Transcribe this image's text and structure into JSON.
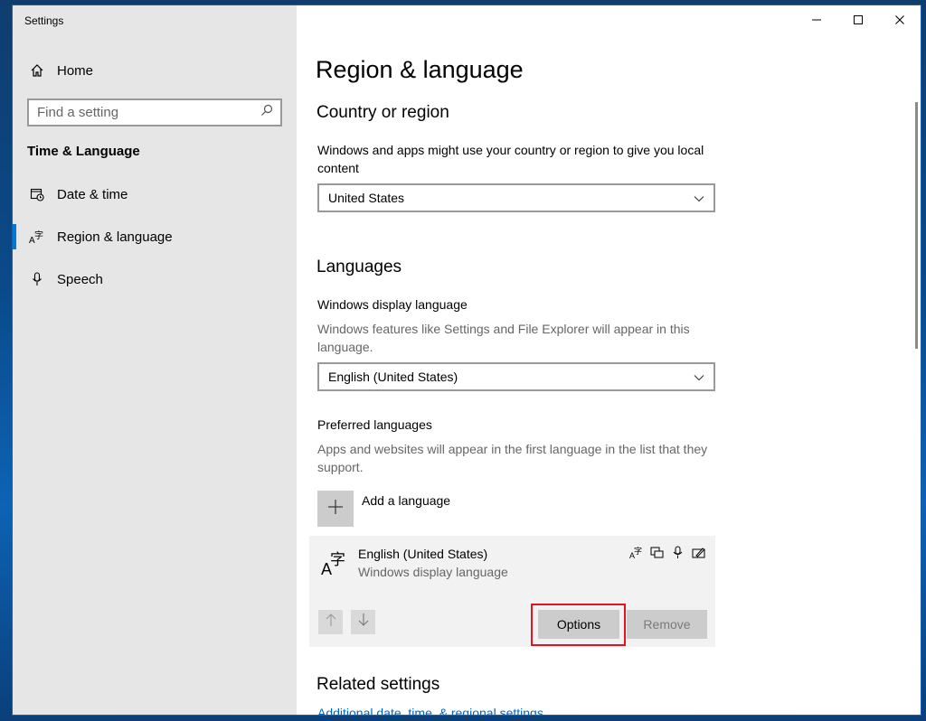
{
  "window": {
    "title": "Settings",
    "controls": [
      "minimize",
      "maximize",
      "close"
    ]
  },
  "sidebar": {
    "home_label": "Home",
    "search_placeholder": "Find a setting",
    "section_title": "Time & Language",
    "items": [
      {
        "label": "Date & time",
        "icon": "calendar-clock-icon",
        "selected": false
      },
      {
        "label": "Region & language",
        "icon": "language-icon",
        "selected": true
      },
      {
        "label": "Speech",
        "icon": "microphone-icon",
        "selected": false
      }
    ]
  },
  "main": {
    "page_title": "Region & language",
    "country": {
      "heading": "Country or region",
      "description": "Windows and apps might use your country or region to give you local content",
      "selected": "United States"
    },
    "languages": {
      "heading": "Languages",
      "display_label": "Windows display language",
      "display_description": "Windows features like Settings and File Explorer will appear in this language.",
      "display_selected": "English (United States)",
      "preferred_label": "Preferred languages",
      "preferred_description": "Apps and websites will appear in the first language in the list that they support.",
      "add_label": "Add a language",
      "entries": [
        {
          "name": "English (United States)",
          "subtitle": "Windows display language",
          "feature_icons": [
            "language-pack-icon",
            "display-language-icon",
            "speech-icon",
            "handwriting-icon"
          ]
        }
      ],
      "options_label": "Options",
      "remove_label": "Remove"
    },
    "related": {
      "heading": "Related settings",
      "link": "Additional date, time, & regional settings"
    }
  },
  "colors": {
    "accent": "#0078d7",
    "highlight_border": "#e81123",
    "link": "#0067c0"
  }
}
